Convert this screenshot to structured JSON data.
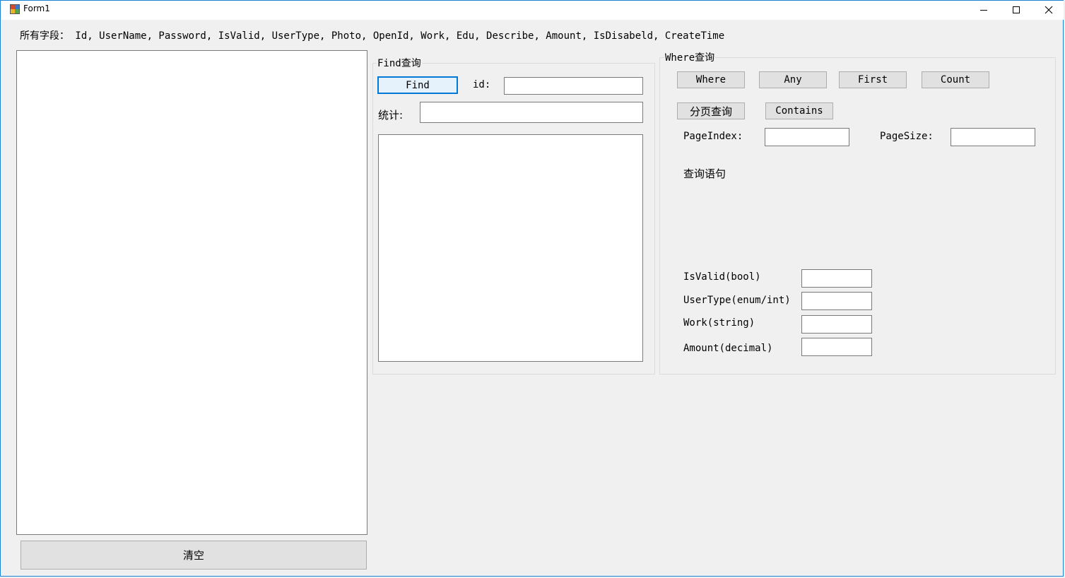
{
  "window": {
    "title": "Form1",
    "minimize_icon": "minimize-icon",
    "maximize_icon": "maximize-icon",
    "close_icon": "close-icon"
  },
  "fields_label": "所有字段： Id, UserName, Password, IsValid, UserType, Photo, OpenId, Work, Edu, Describe, Amount, IsDisabeld, CreateTime",
  "output": {
    "text": ""
  },
  "clear_button": "清空",
  "find_group": {
    "title": "Find查询",
    "find_button": "Find",
    "id_label": "id:",
    "id_value": "",
    "stat_label": "统计:",
    "stat_value": "",
    "result_text": ""
  },
  "where_group": {
    "title": "Where查询",
    "buttons": {
      "where": "Where",
      "any": "Any",
      "first": "First",
      "count": "Count",
      "paging": "分页查询",
      "contains": "Contains"
    },
    "page_index_label": "PageIndex:",
    "page_index_value": "",
    "page_size_label": "PageSize:",
    "page_size_value": "",
    "query_label": "查询语句",
    "params": [
      {
        "label": "IsValid(bool)",
        "value": ""
      },
      {
        "label": "UserType(enum/int)",
        "value": ""
      },
      {
        "label": "Work(string)",
        "value": ""
      },
      {
        "label": "Amount(decimal)",
        "value": ""
      }
    ]
  },
  "colors": {
    "background": "#f0f0f0",
    "window_border": "#1883d7",
    "focus_border": "#0078d7",
    "button_face": "#e1e1e1"
  }
}
